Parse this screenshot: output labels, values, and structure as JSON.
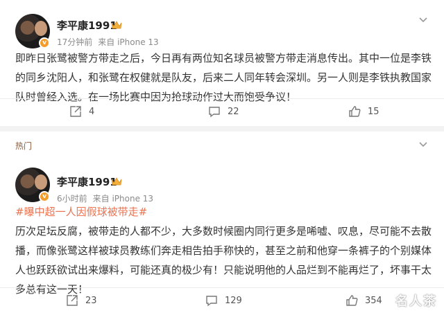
{
  "post1": {
    "username": "李平康1991",
    "time": "17分钟前",
    "source": "来自 iPhone 13",
    "text": "即昨日张鹭被警方带走之后，今日再有两位知名球员被警方带走消息传出。其中一位是李铁的同乡沈阳人，和张鹭在权健就是队友，后来二人同年转会深圳。另一人则是李铁执教国家队时曾经入选。在一场比赛中因为抢球动作过大而饱受争议！",
    "shares": "4",
    "comments": "22",
    "likes": "15"
  },
  "post2": {
    "hot_label": "热门",
    "username": "李平康1991",
    "time": "6小时前",
    "source": "来自 iPhone 13",
    "hashtag": "#曝中超一人因假球被带走#",
    "text": "历次足坛反腐，被带走的人都不少，大多数时候圈内同行更多是唏嘘、叹息，尽可能不去散播，而像张鹭这样被球员教练们奔走相告拍手称快的，甚至之前和他穿一条裤子的个别媒体人也跃跃欲试出来爆料，可能还真的极少有！只能说明他的人品烂到不能再烂了，坏事干太多总有这一天！",
    "shares": "23",
    "comments": "129",
    "likes": "354"
  },
  "watermark": "名人茶",
  "colors": {
    "tag": "#eb7350",
    "badge": "#f59d2a",
    "background": "#f2f2f2"
  },
  "icons": [
    "share-icon",
    "comment-icon",
    "like-icon",
    "chevron-down-icon",
    "verified-badge-icon",
    "crown-icon"
  ]
}
